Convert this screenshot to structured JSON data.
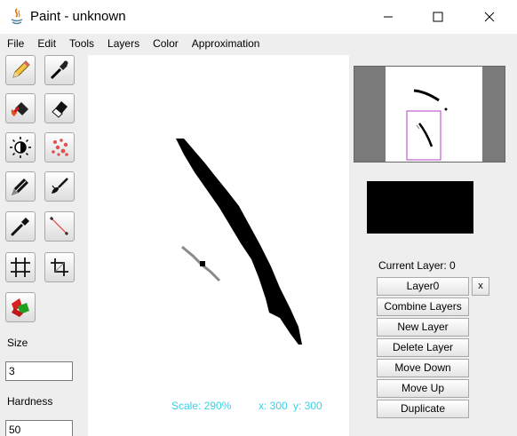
{
  "window": {
    "title": "Paint - unknown"
  },
  "menu": [
    "File",
    "Edit",
    "Tools",
    "Layers",
    "Color",
    "Approximation"
  ],
  "tools": [
    {
      "icon": "pencil-icon"
    },
    {
      "icon": "eyedropper-brush-icon"
    },
    {
      "icon": "fill-bucket-icon"
    },
    {
      "icon": "eraser-icon"
    },
    {
      "icon": "brightness-icon"
    },
    {
      "icon": "spray-icon"
    },
    {
      "icon": "marker-icon"
    },
    {
      "icon": "smudge-brush-icon"
    },
    {
      "icon": "color-picker-icon"
    },
    {
      "icon": "line-icon"
    },
    {
      "icon": "grid-icon"
    },
    {
      "icon": "crop-icon"
    },
    {
      "icon": "color-swap-icon"
    }
  ],
  "sidebar": {
    "size_label": "Size",
    "size_value": "3",
    "hardness_label": "Hardness",
    "hardness_value": "50"
  },
  "status": {
    "scale": "Scale: 290%",
    "x": "x: 300",
    "y": "y: 300"
  },
  "colors": {
    "status_text": "#3ad0e8",
    "current_color": "#000000",
    "navigator_frame": "#b040c0"
  },
  "layers": {
    "current_label": "Current Layer: 0",
    "list": [
      "Layer0"
    ],
    "delete_single": "x",
    "actions": [
      "Combine Layers",
      "New Layer",
      "Delete Layer",
      "Move Down",
      "Move Up",
      "Duplicate"
    ]
  }
}
